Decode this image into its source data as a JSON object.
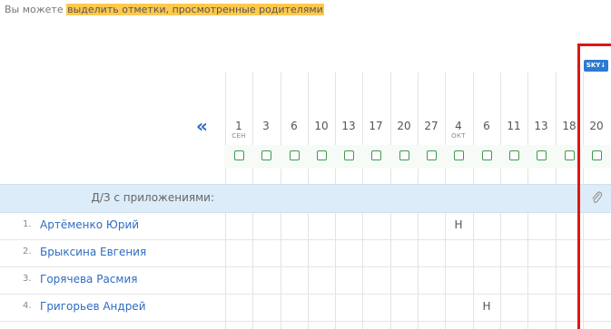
{
  "note": {
    "prefix": "Вы можете ",
    "highlight": "выделить отметки, просмотренные родителями"
  },
  "nav": {
    "back": "«"
  },
  "sky_button": "SKY↓",
  "dates": [
    {
      "day": "1",
      "month": "СЕН"
    },
    {
      "day": "3",
      "month": ""
    },
    {
      "day": "6",
      "month": ""
    },
    {
      "day": "10",
      "month": ""
    },
    {
      "day": "13",
      "month": ""
    },
    {
      "day": "17",
      "month": ""
    },
    {
      "day": "20",
      "month": ""
    },
    {
      "day": "27",
      "month": ""
    },
    {
      "day": "4",
      "month": "ОКТ"
    },
    {
      "day": "6",
      "month": ""
    },
    {
      "day": "11",
      "month": ""
    },
    {
      "day": "13",
      "month": ""
    },
    {
      "day": "18",
      "month": ""
    },
    {
      "day": "20",
      "month": ""
    }
  ],
  "homework_row": {
    "label": "Д/З с приложениями:",
    "icon": "paperclip-icon"
  },
  "students": [
    {
      "num": "1.",
      "name": "Артёменко Юрий",
      "marks": [
        {
          "col": 8,
          "value": "Н"
        }
      ]
    },
    {
      "num": "2.",
      "name": "Брыксина Евгения",
      "marks": []
    },
    {
      "num": "3.",
      "name": "Горячева Расмия",
      "marks": []
    },
    {
      "num": "4.",
      "name": "Григорьев Андрей",
      "marks": [
        {
          "col": 9,
          "value": "Н"
        }
      ]
    }
  ],
  "colors": {
    "link": "#2d6cc4",
    "highlight": "#ffc94d",
    "checkbox": "#3e9a4a",
    "band": "#dcecf8",
    "annotation": "#e01515"
  }
}
